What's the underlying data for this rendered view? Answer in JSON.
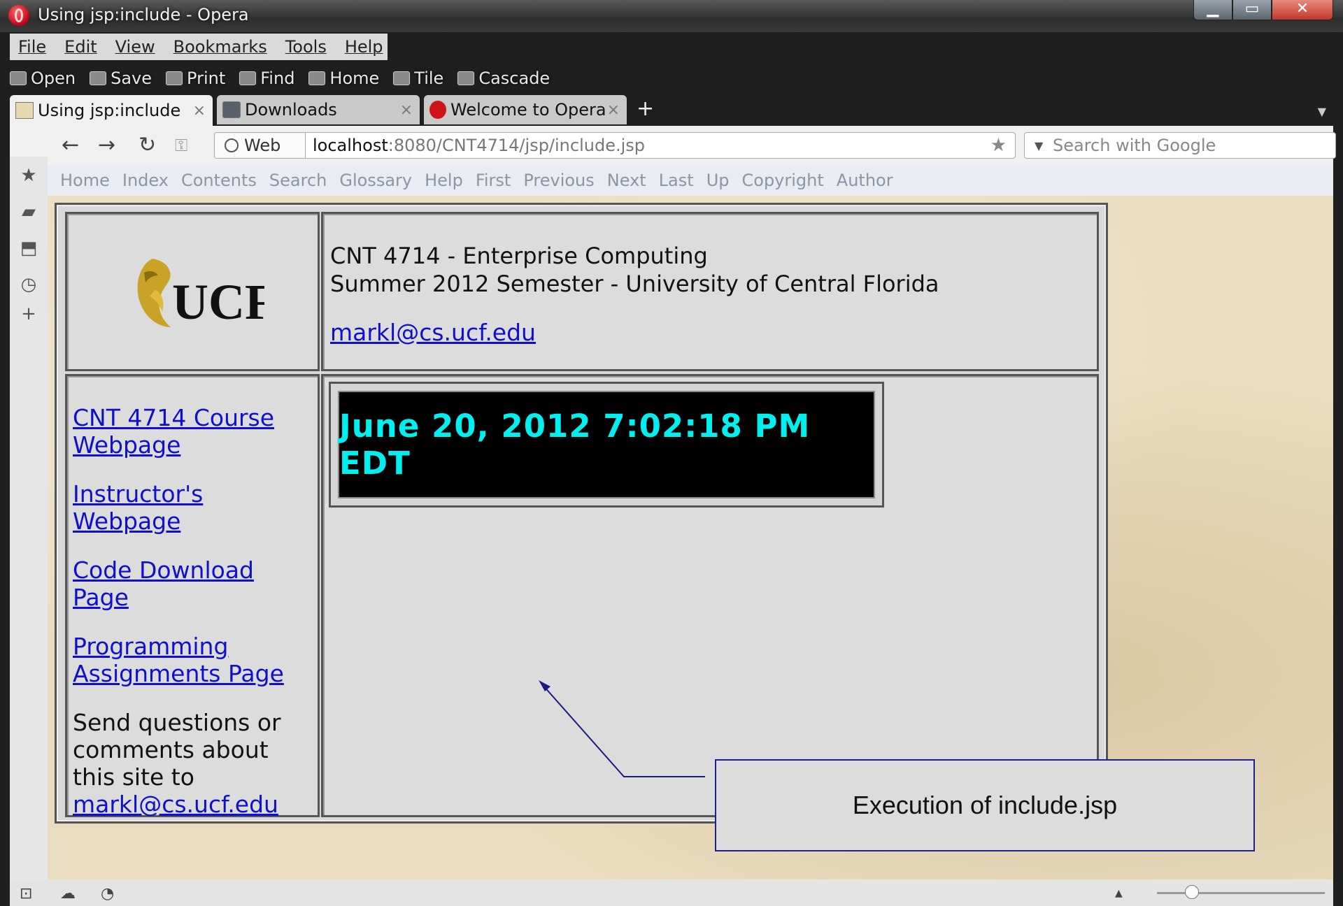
{
  "window": {
    "title": "Using jsp:include - Opera",
    "controls": {
      "minimize": "▁",
      "maximize": "▭",
      "close": "✕"
    }
  },
  "menu": {
    "items": [
      "File",
      "Edit",
      "View",
      "Bookmarks",
      "Tools",
      "Help"
    ]
  },
  "toolbar": {
    "items": [
      {
        "label": "Open",
        "icon": "open-icon"
      },
      {
        "label": "Save",
        "icon": "save-icon"
      },
      {
        "label": "Print",
        "icon": "print-icon"
      },
      {
        "label": "Find",
        "icon": "find-icon"
      },
      {
        "label": "Home",
        "icon": "home-icon"
      },
      {
        "label": "Tile",
        "icon": "tile-icon"
      },
      {
        "label": "Cascade",
        "icon": "cascade-icon"
      }
    ]
  },
  "tabs": [
    {
      "label": "Using jsp:include",
      "close": "×",
      "active": true
    },
    {
      "label": "Downloads",
      "close": "×",
      "active": false
    },
    {
      "label": "Welcome to Opera",
      "close": "×",
      "active": false
    }
  ],
  "new_tab": "+",
  "address": {
    "web_label": "Web",
    "url_host": "localhost",
    "url_path": ":8080/CNT4714/jsp/include.jsp",
    "search_placeholder": "Search with Google"
  },
  "navlinks": [
    "Home",
    "Index",
    "Contents",
    "Search",
    "Glossary",
    "Help",
    "First",
    "Previous",
    "Next",
    "Last",
    "Up",
    "Copyright",
    "Author"
  ],
  "page": {
    "logo_text": "UCF",
    "course_title": "CNT 4714 - Enterprise Computing",
    "semester": "Summer 2012 Semester - University of Central Florida",
    "email": "markl@cs.ucf.edu",
    "links": {
      "course_line1": "CNT 4714 Course",
      "course_line2": "Webpage",
      "instructor_line1": "Instructor's",
      "instructor_line2": "Webpage",
      "code_download": "Code Download Page",
      "assign_line1": "Programming",
      "assign_line2": "Assignments Page"
    },
    "note": "Send questions or comments about this site to",
    "note_email": "markl@cs.ucf.edu",
    "clock": "June 20, 2012 7:02:18 PM EDT"
  },
  "callout": {
    "text": "Execution of include.jsp"
  },
  "colors": {
    "link": "#1010cc",
    "clock_text": "#00f0f0",
    "callout_border": "#20208a"
  }
}
